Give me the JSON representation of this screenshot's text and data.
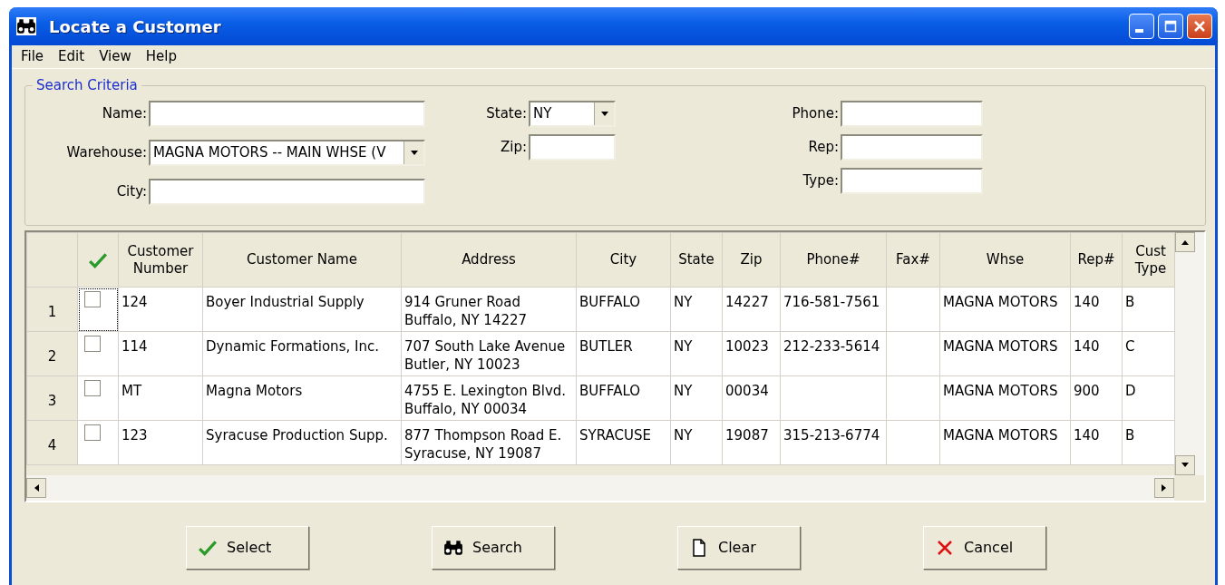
{
  "window": {
    "title": "Locate a Customer"
  },
  "menu": [
    "File",
    "Edit",
    "View",
    "Help"
  ],
  "search_criteria": {
    "title": "Search Criteria",
    "field_columns": [
      {
        "fields": [
          {
            "label": "Name:",
            "kind": "text"
          },
          {
            "label": "Warehouse:",
            "kind": "dropdown",
            "value": "MAGNA MOTORS -- MAIN WHSE (V"
          },
          {
            "label": "City:",
            "kind": "text"
          }
        ]
      },
      {
        "fields": [
          {
            "label": "State:",
            "kind": "dropdown",
            "value": "NY"
          },
          {
            "label": "Zip:",
            "kind": "text"
          }
        ]
      },
      {
        "fields": [
          {
            "label": "Phone:",
            "kind": "text"
          },
          {
            "label": "Rep:",
            "kind": "text"
          },
          {
            "label": "Type:",
            "kind": "text"
          }
        ]
      }
    ]
  },
  "table": {
    "columns": [
      "Customer Number",
      "Customer Name",
      "Address",
      "City",
      "State",
      "Zip",
      "Phone#",
      "Fax#",
      "Whse",
      "Rep#",
      "Cust Type"
    ],
    "rows": [
      {
        "row_number": "1",
        "checked": false,
        "focused": true,
        "cells": [
          "124",
          "Boyer Industrial Supply",
          "914 Gruner Road",
          "BUFFALO",
          "NY",
          "14227",
          "716-581-7561",
          "",
          "MAGNA MOTORS",
          "140",
          "B"
        ],
        "address_line_2": "Buffalo, NY 14227"
      },
      {
        "row_number": "2",
        "checked": false,
        "focused": false,
        "cells": [
          "114",
          "Dynamic Formations, Inc.",
          "707 South Lake Avenue",
          "BUTLER",
          "NY",
          "10023",
          "212-233-5614",
          "",
          "MAGNA MOTORS",
          "140",
          "C"
        ],
        "address_line_2": "Butler, NY 10023"
      },
      {
        "row_number": "3",
        "checked": false,
        "focused": false,
        "cells": [
          "MT",
          "Magna Motors",
          "4755 E. Lexington Blvd.",
          "BUFFALO",
          "NY",
          "00034",
          "",
          "",
          "MAGNA MOTORS",
          "900",
          "D"
        ],
        "address_line_2": "Buffalo, NY 00034"
      },
      {
        "row_number": "4",
        "checked": false,
        "focused": false,
        "cells": [
          "123",
          "Syracuse Production Supp.",
          "877 Thompson Road E.",
          "SYRACUSE",
          "NY",
          "19087",
          "315-213-6774",
          "",
          "MAGNA MOTORS",
          "140",
          "B"
        ],
        "address_line_2": "Syracuse, NY 19087"
      }
    ]
  },
  "buttons": [
    {
      "label": "Select",
      "kind": "select"
    },
    {
      "label": "Search",
      "kind": "search"
    },
    {
      "label": "Clear",
      "kind": "clear"
    },
    {
      "label": "Cancel",
      "kind": "cancel"
    }
  ]
}
